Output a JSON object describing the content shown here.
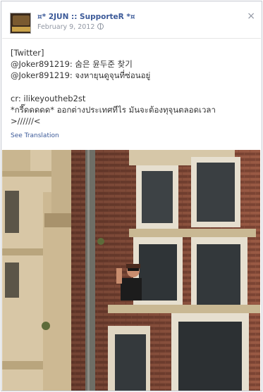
{
  "post": {
    "page_name": "¤* 2JUN :: SupporteR *¤",
    "date": "February 9, 2012",
    "close_symbol": "×",
    "lines": [
      "[Twitter]",
      "@Joker891219: 숨은 윤두준 찾기",
      "@Joker891219: จงหายุนดูจุนที่ซ่อนอยู่",
      "",
      "cr: ilikeyoutheb2st",
      "*กรี๊ดดดดด* ออกต่างประเทศทีไร มันจะต้องทุจุนตลอดเวลา",
      ">//////<"
    ],
    "see_translation": "See Translation"
  },
  "colors": {
    "link": "#3b5998",
    "meta": "#9197a3",
    "text": "#333333",
    "brick": "#8a4f3c",
    "stone": "#d8c7a6"
  },
  "icons": {
    "privacy": "globe-icon",
    "close": "close-icon"
  }
}
